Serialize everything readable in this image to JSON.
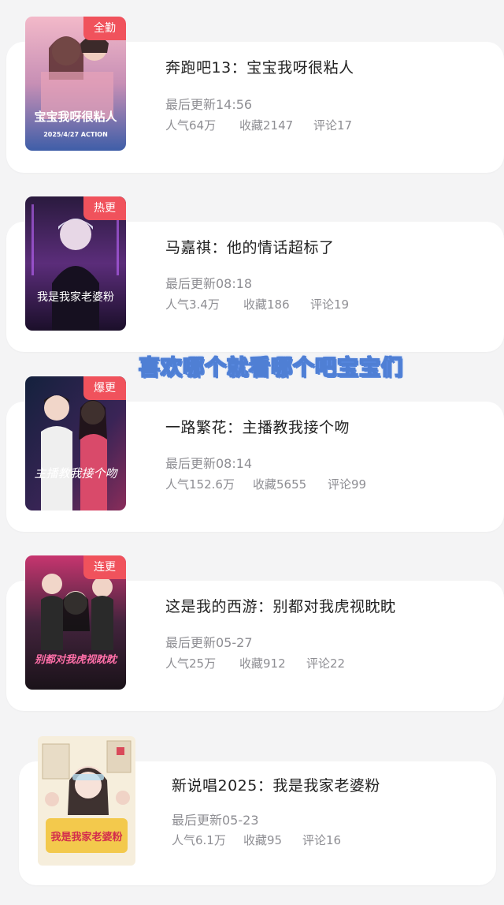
{
  "overlay_caption": "喜欢哪个就看哪个吧宝宝们",
  "colors": {
    "badge": "#f0525c",
    "caption_outline": "#4f7fd4",
    "meta_text": "#8e8e93"
  },
  "items": [
    {
      "badge": "全勤",
      "title": "奔跑吧13：宝宝我呀很粘人",
      "updated": "最后更新14:56",
      "popularity": "人气64万",
      "favorites": "收藏2147",
      "comments": "评论17",
      "cover_text": "宝宝我呀很粘人",
      "cover_sub": "2025/4/27 ACTION"
    },
    {
      "badge": "热更",
      "title": "马嘉祺：他的情话超标了",
      "updated": "最后更新08:18",
      "popularity": "人气3.4万",
      "favorites": "收藏186",
      "comments": "评论19",
      "cover_text": "我是我家老婆粉"
    },
    {
      "badge": "爆更",
      "title": "一路繁花：主播教我接个吻",
      "updated": "最后更新08:14",
      "popularity": "人气152.6万",
      "favorites": "收藏5655",
      "comments": "评论99",
      "cover_text": "主播教我接个吻"
    },
    {
      "badge": "连更",
      "title": "这是我的西游：别都对我虎视眈眈",
      "updated": "最后更新05-27",
      "popularity": "人气25万",
      "favorites": "收藏912",
      "comments": "评论22",
      "cover_text": "别都对我虎视眈眈"
    },
    {
      "badge": "",
      "title": "新说唱2025：我是我家老婆粉",
      "updated": "最后更新05-23",
      "popularity": "人气6.1万",
      "favorites": "收藏95",
      "comments": "评论16",
      "cover_text": "我是我家老婆粉"
    }
  ]
}
